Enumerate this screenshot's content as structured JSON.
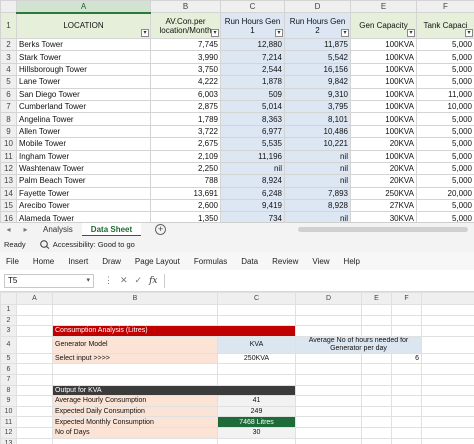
{
  "sheet_top": {
    "columns": [
      "A",
      "B",
      "C",
      "D",
      "E",
      "F"
    ],
    "headers": [
      "LOCATION",
      "AV.Con.per location/Month",
      "Run Hours Gen 1",
      "Run Hours Gen 2",
      "Gen Capacity",
      "Tank Capaci"
    ],
    "rows": [
      {
        "n": "2",
        "cells": [
          "Berks Tower",
          "7,745",
          "12,880",
          "11,875",
          "100KVA",
          "5,000"
        ]
      },
      {
        "n": "3",
        "cells": [
          "Stark Tower",
          "3,990",
          "7,214",
          "5,542",
          "100KVA",
          "5,000"
        ]
      },
      {
        "n": "4",
        "cells": [
          "Hillsborough Tower",
          "3,750",
          "2,544",
          "16,156",
          "100KVA",
          "5,000"
        ]
      },
      {
        "n": "5",
        "cells": [
          "Lane Tower",
          "4,222",
          "1,878",
          "9,842",
          "100KVA",
          "5,000"
        ]
      },
      {
        "n": "6",
        "cells": [
          "San Diego Tower",
          "6,003",
          "509",
          "9,310",
          "100KVA",
          "11,000"
        ]
      },
      {
        "n": "7",
        "cells": [
          "Cumberland Tower",
          "2,875",
          "5,014",
          "3,795",
          "100KVA",
          "10,000"
        ]
      },
      {
        "n": "8",
        "cells": [
          "Angelina Tower",
          "1,789",
          "8,363",
          "8,101",
          "100KVA",
          "5,000"
        ]
      },
      {
        "n": "9",
        "cells": [
          "Allen Tower",
          "3,722",
          "6,977",
          "10,486",
          "100KVA",
          "5,000"
        ]
      },
      {
        "n": "10",
        "cells": [
          "Mobile Tower",
          "2,675",
          "5,535",
          "10,221",
          "20KVA",
          "5,000"
        ]
      },
      {
        "n": "11",
        "cells": [
          "Ingham Tower",
          "2,109",
          "11,196",
          "nil",
          "100KVA",
          "5,000"
        ]
      },
      {
        "n": "12",
        "cells": [
          "Washtenaw Tower",
          "2,250",
          "nil",
          "nil",
          "20KVA",
          "5,000"
        ]
      },
      {
        "n": "13",
        "cells": [
          "Palm Beach Tower",
          "788",
          "8,924",
          "nil",
          "20KVA",
          "5,000"
        ]
      },
      {
        "n": "14",
        "cells": [
          "Fayette Tower",
          "13,691",
          "6,248",
          "7,893",
          "250KVA",
          "20,000"
        ]
      },
      {
        "n": "15",
        "cells": [
          "Arecibo Tower",
          "2,600",
          "9,419",
          "8,928",
          "27KVA",
          "5,000"
        ]
      },
      {
        "n": "16",
        "cells": [
          "Alameda Tower",
          "1,350",
          "734",
          "nil",
          "30KVA",
          "5,000"
        ]
      }
    ]
  },
  "tabs": {
    "items": [
      "Analysis",
      "Data Sheet"
    ],
    "active": "Data Sheet",
    "add_label": "+"
  },
  "status": {
    "ready": "Ready",
    "accessibility": "Accessibility: Good to go"
  },
  "menu": [
    "File",
    "Home",
    "Insert",
    "Draw",
    "Page Layout",
    "Formulas",
    "Data",
    "Review",
    "View",
    "Help"
  ],
  "formula_bar": {
    "name_box": "T5",
    "fx": "fx",
    "value": ""
  },
  "sheet_bottom": {
    "columns": [
      "A",
      "B",
      "C",
      "D",
      "E",
      "F"
    ],
    "row_numbers": [
      "1",
      "2",
      "3",
      "4",
      "5",
      "6",
      "7",
      "8",
      "9",
      "10",
      "11",
      "12",
      "13",
      "14"
    ],
    "consumption_title": "Consumption Analysis (Litres)",
    "generator_model_label": "Generator Model",
    "kva_label": "KVA",
    "avg_hours_label": "Average No of hours needed for Generator per day",
    "select_input_label": "Select input >>>>",
    "selected_kva": "250KVA",
    "avg_hours_value": "6",
    "output_label": "Output for KVA",
    "avg_hourly_label": "Average Hourly Consumption",
    "avg_hourly_value": "41",
    "expected_daily_label": "Expected Daily Consumption",
    "expected_daily_value": "249",
    "expected_monthly_label": "Expected Monthly Consumption",
    "expected_monthly_value": "7468 Litres",
    "days_label": "No of Days",
    "days_value": "30"
  }
}
